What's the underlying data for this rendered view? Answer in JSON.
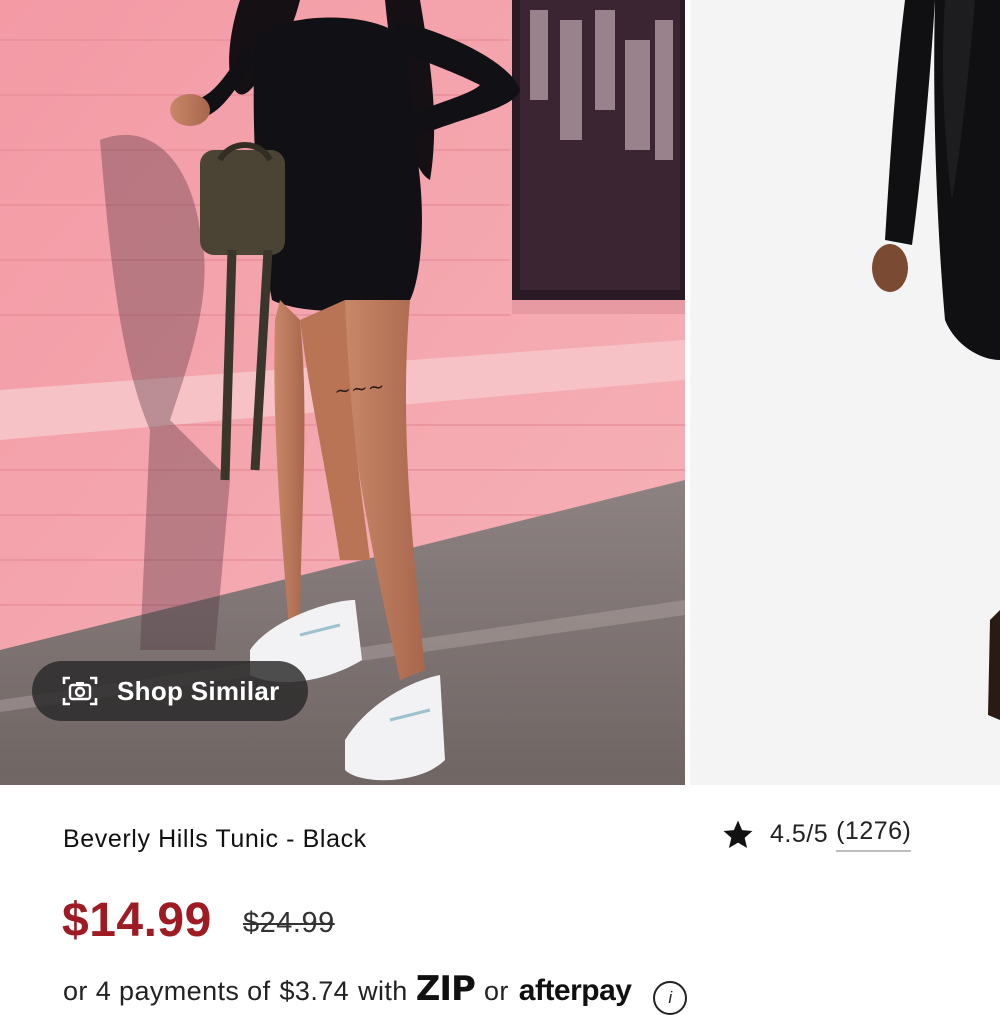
{
  "gallery": {
    "shop_similar_label": "Shop Similar",
    "shop_similar_icon": "camera-icon"
  },
  "product": {
    "title": "Beverly Hills Tunic - Black",
    "rating": "4.5/5",
    "review_count": "(1276)",
    "price": "$14.99",
    "original_price": "$24.99",
    "installment_prefix": "or 4 payments of",
    "installment_amount": "$3.74",
    "installment_with": "with",
    "zip_label": "ZIP",
    "or_label": "or",
    "afterpay_label": "afterpay",
    "info_glyph": "i"
  },
  "colors": {
    "price": "#9e1b24",
    "wall": "#f4a0a8",
    "background": "#ffffff"
  }
}
